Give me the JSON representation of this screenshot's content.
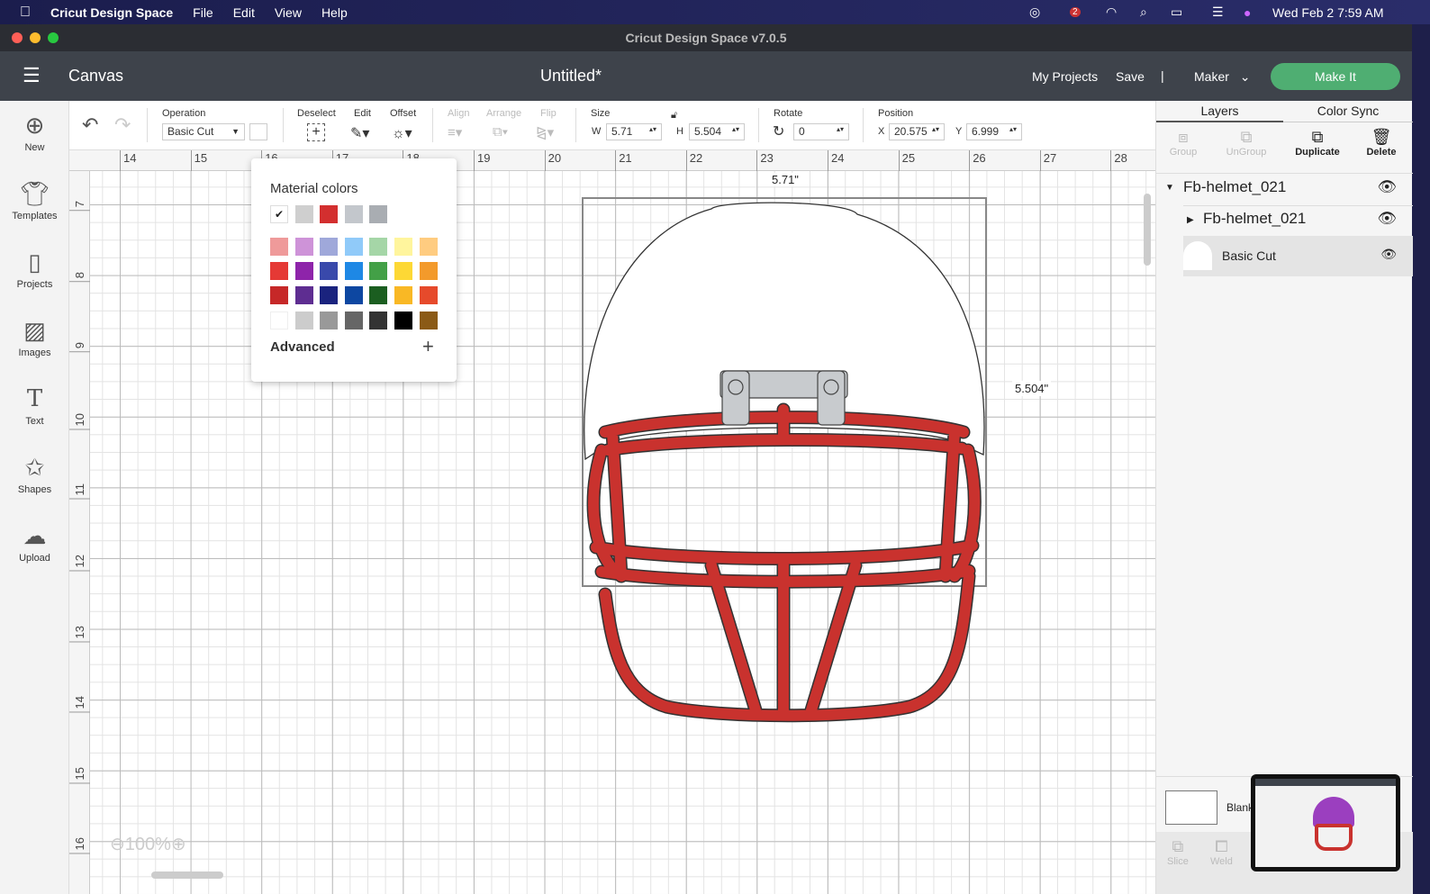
{
  "menubar": {
    "app": "Cricut Design Space",
    "items": [
      "File",
      "Edit",
      "View",
      "Help"
    ],
    "datetime": "Wed Feb 2  7:59 AM",
    "badge": "2"
  },
  "window": {
    "title": "Cricut Design Space  v7.0.5"
  },
  "header": {
    "section": "Canvas",
    "doc_title": "Untitled*",
    "my_projects": "My Projects",
    "save": "Save",
    "divider": "|",
    "machine": "Maker",
    "make_it": "Make It",
    "make_it_color": "#4fae72"
  },
  "toolbar": {
    "operation_label": "Operation",
    "operation_value": "Basic Cut",
    "deselect": "Deselect",
    "edit": "Edit",
    "offset": "Offset",
    "align": "Align",
    "arrange": "Arrange",
    "flip": "Flip",
    "size_label": "Size",
    "w_label": "W",
    "w_value": "5.71",
    "h_label": "H",
    "h_value": "5.504",
    "rotate_label": "Rotate",
    "rotate_value": "0",
    "position_label": "Position",
    "x_label": "X",
    "x_value": "20.575",
    "y_label": "Y",
    "y_value": "6.999"
  },
  "sidebar": {
    "items": [
      {
        "label": "New"
      },
      {
        "label": "Templates"
      },
      {
        "label": "Projects"
      },
      {
        "label": "Images"
      },
      {
        "label": "Text"
      },
      {
        "label": "Shapes"
      },
      {
        "label": "Upload"
      }
    ]
  },
  "ruler": {
    "x": [
      "14",
      "15",
      "16",
      "17",
      "18",
      "19",
      "20",
      "21",
      "22",
      "23",
      "24",
      "25",
      "26",
      "27",
      "28"
    ],
    "y": [
      "7",
      "8",
      "9",
      "10",
      "11",
      "12",
      "13",
      "14",
      "15",
      "16"
    ]
  },
  "canvas": {
    "width_label": "5.71\"",
    "height_label": "5.504\"",
    "zoom": "100%"
  },
  "palette": {
    "title": "Material colors",
    "advanced": "Advanced",
    "top_row": [
      "#ffffff",
      "#cfcfcf",
      "#d32f2f",
      "#c3c7cc",
      "#a9adb2"
    ],
    "grid": [
      [
        "#ef9a9a",
        "#ce93d8",
        "#9fa8da",
        "#90caf9",
        "#a5d6a7",
        "#fff59d",
        "#ffcc80"
      ],
      [
        "#e53935",
        "#8e24aa",
        "#3949ab",
        "#1e88e5",
        "#43a047",
        "#fdd835",
        "#f39a2b"
      ],
      [
        "#c62828",
        "#5e2d91",
        "#1a237e",
        "#0d47a1",
        "#1b5e20",
        "#f9b825",
        "#e64a2b"
      ],
      [
        "#ffffff",
        "#cccccc",
        "#999999",
        "#666666",
        "#333333",
        "#000000",
        "#8b5a16"
      ]
    ]
  },
  "right": {
    "tabs": [
      "Layers",
      "Color Sync"
    ],
    "actions": [
      "Group",
      "UnGroup",
      "Duplicate",
      "Delete"
    ],
    "layers": [
      "Fb-helmet_021",
      "Fb-helmet_021",
      "Basic Cut"
    ],
    "blank": "Blank",
    "bottom": [
      "Slice",
      "Weld"
    ]
  },
  "helmet": {
    "cage_color": "#c9322e",
    "shell_color": "#ffffff",
    "clip_color": "#c8cbce"
  }
}
